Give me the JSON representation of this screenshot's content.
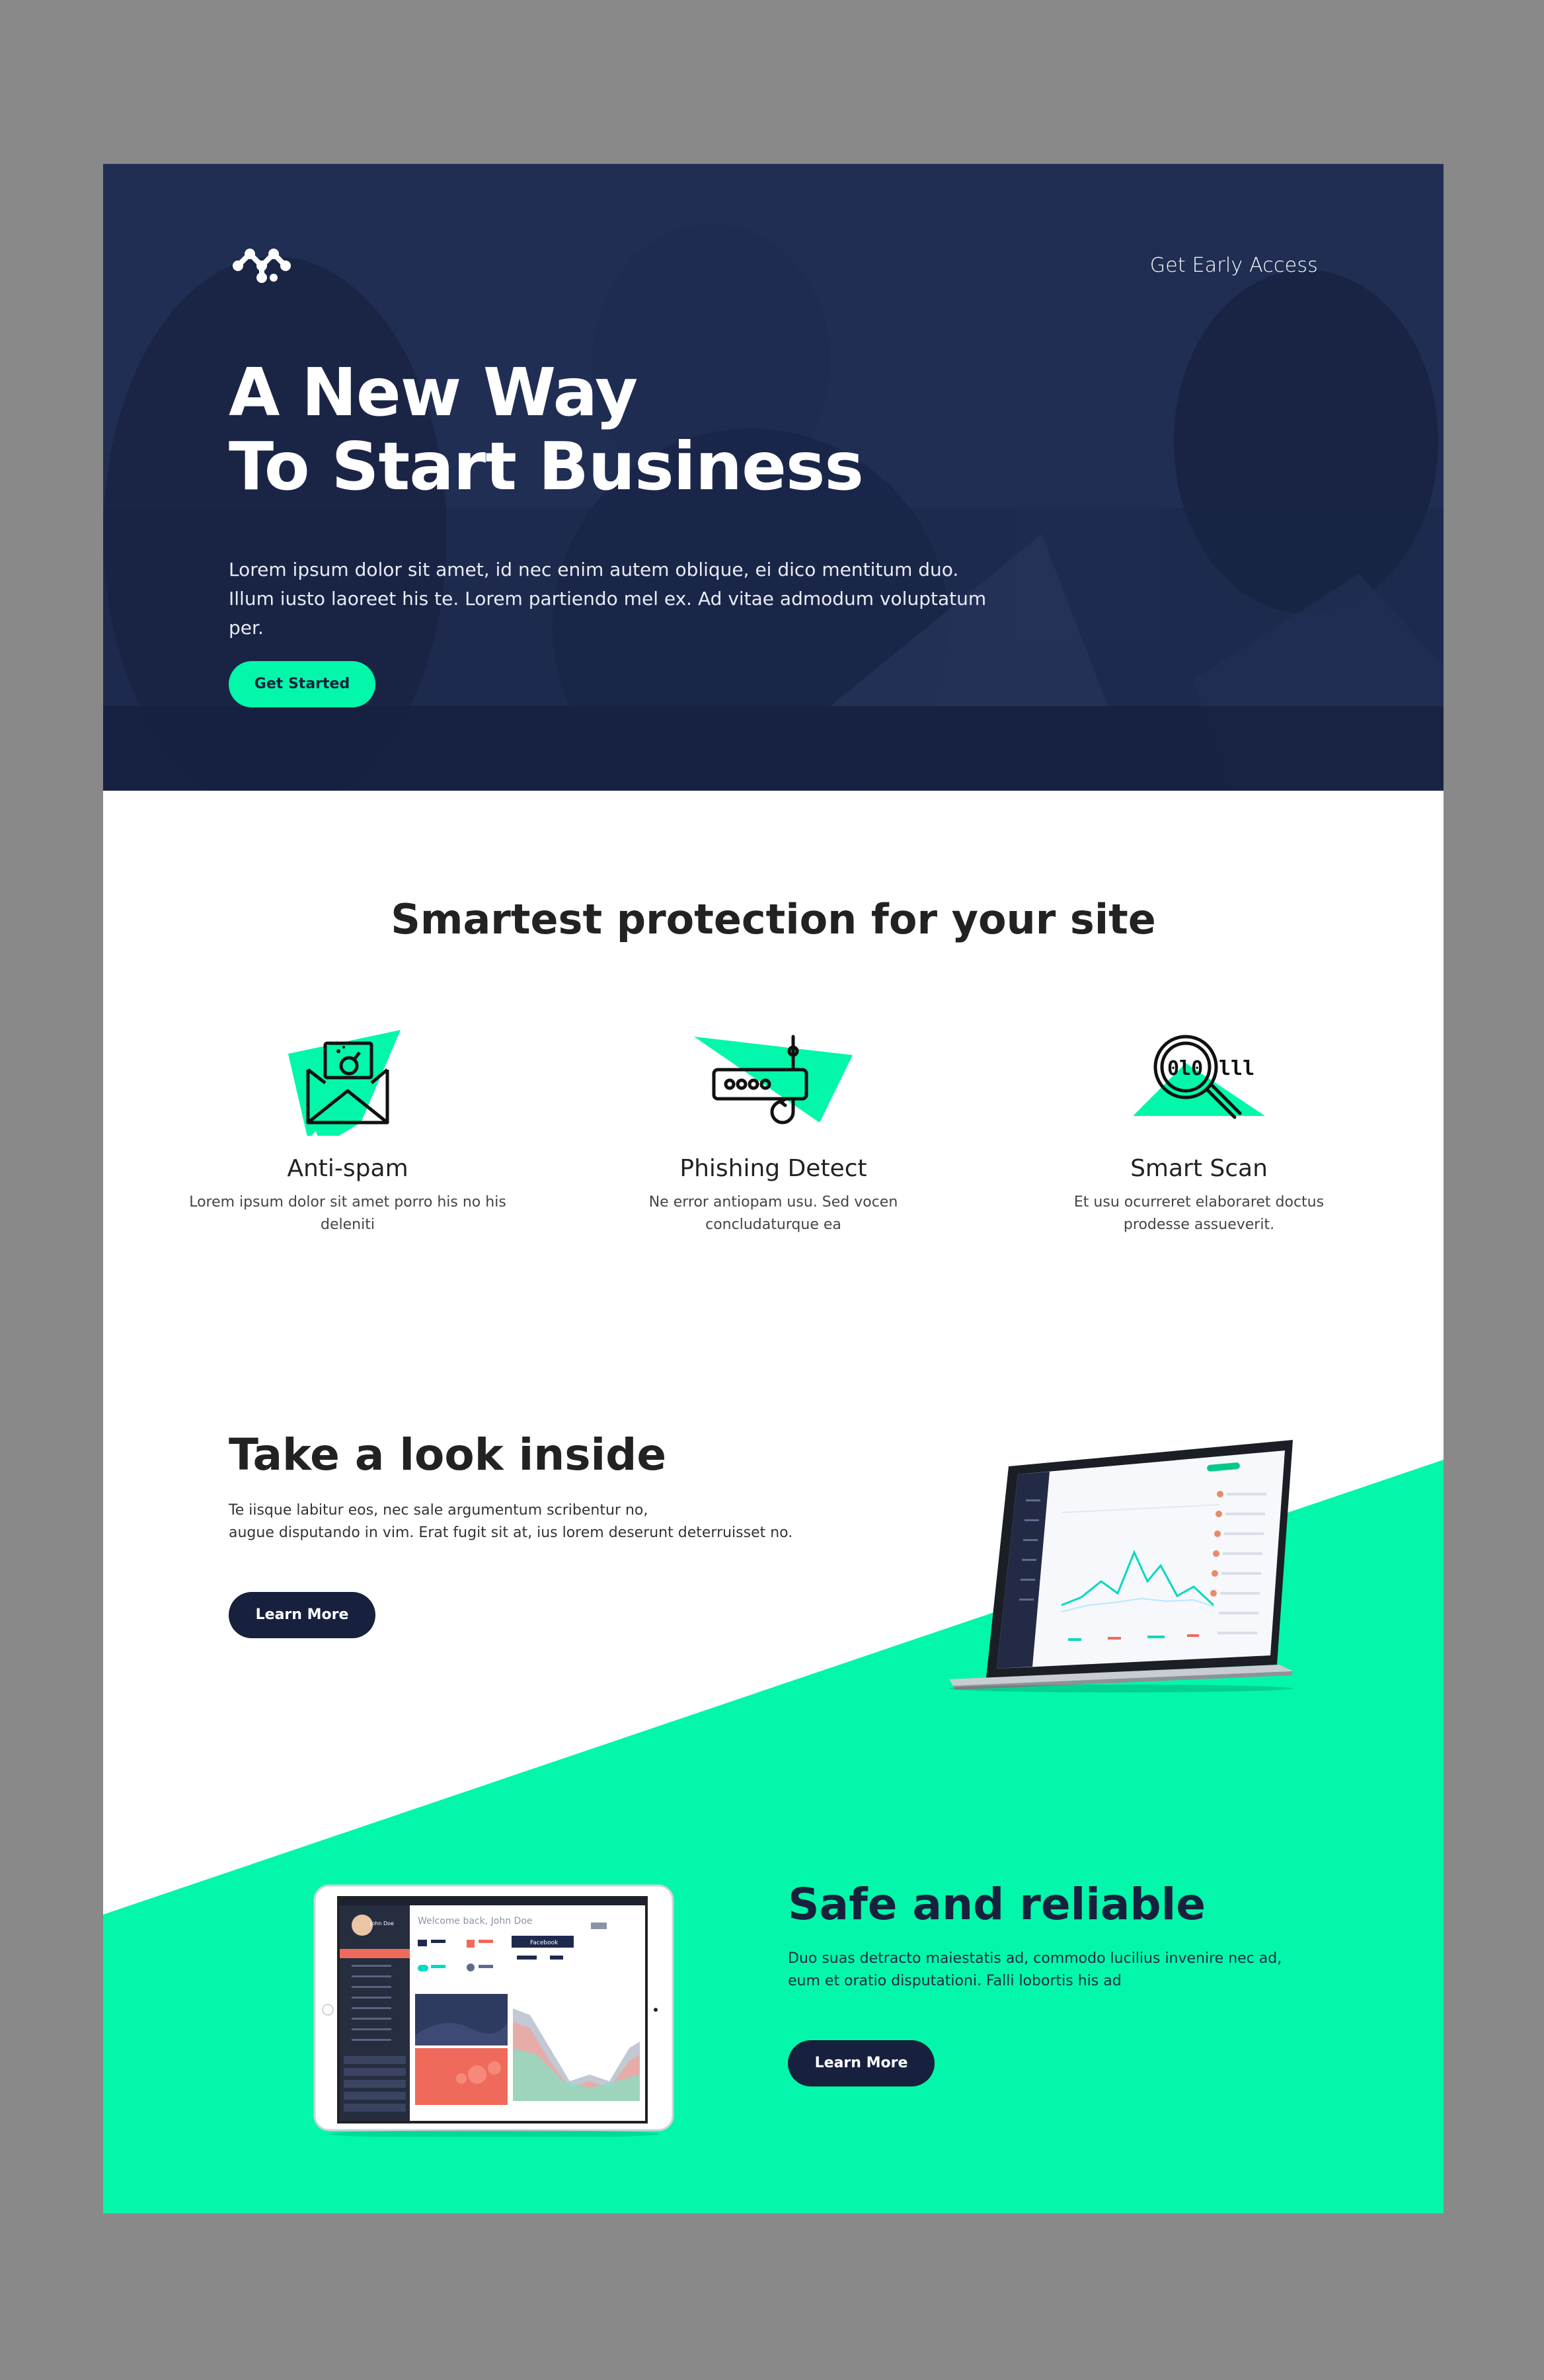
{
  "colors": {
    "accent": "#02f7aa",
    "navy": "#17213d",
    "hero_bg": "#1e2a4d",
    "frame": "#898989"
  },
  "header": {
    "logo_icon": "brand-logo-icon",
    "cta_link": "Get Early Access"
  },
  "hero": {
    "title_line1": "A New Way",
    "title_line2": "To Start Business",
    "text_line1": "Lorem ipsum dolor sit amet, id nec enim autem oblique, ei dico mentitum duo.",
    "text_line2": "Illum iusto laoreet his te. Lorem partiendo mel ex. Ad vitae admodum voluptatum per.",
    "button": "Get Started"
  },
  "features": {
    "title": "Smartest protection for your site",
    "items": [
      {
        "icon": "envelope-bomb-icon",
        "title": "Anti-spam",
        "text": "Lorem ipsum dolor sit amet porro his no his deleniti"
      },
      {
        "icon": "router-hook-icon",
        "title": "Phishing Detect",
        "text": "Ne error antiopam usu. Sed vocen concludaturque ea"
      },
      {
        "icon": "magnifier-binary-icon",
        "title": "Smart Scan",
        "text": "Et usu ocurreret elaboraret doctus prodesse assueverit."
      }
    ]
  },
  "look_inside": {
    "title": "Take a look inside",
    "text_line1": "Te iisque labitur eos, nec sale argumentum scribentur no,",
    "text_line2": "augue disputando in vim. Erat fugit sit at, ius lorem deserunt deterruisset no.",
    "button": "Learn More"
  },
  "safe": {
    "title": "Safe and reliable",
    "text_line1": "Duo suas detracto maiestatis ad, commodo lucilius invenire nec ad,",
    "text_line2": "eum et oratio disputationi. Falli lobortis his ad",
    "button": "Learn More"
  },
  "tablet_screen": {
    "welcome": "Welcome back, John Doe",
    "user": "John Doe",
    "tab": "Facebook"
  }
}
